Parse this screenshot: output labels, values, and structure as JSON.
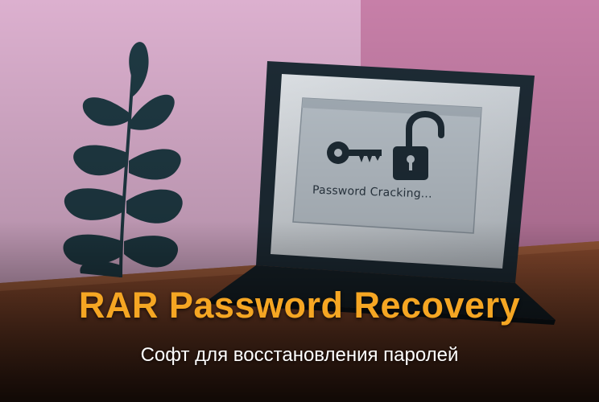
{
  "banner": {
    "screen_label": "Password Cracking...",
    "headline": "RAR Password Recovery",
    "subtitle": "Софт для восстановления паролей"
  },
  "icons": [
    "plant-illustration",
    "laptop-illustration",
    "key-icon",
    "open-padlock-icon"
  ],
  "colors": {
    "headline": "#f5a623",
    "subtitle": "#ffffff",
    "wall_left": "#dcb0cf",
    "wall_right": "#c77fa8",
    "laptop": "#1e2c36",
    "desk": "#8a4a2e"
  }
}
